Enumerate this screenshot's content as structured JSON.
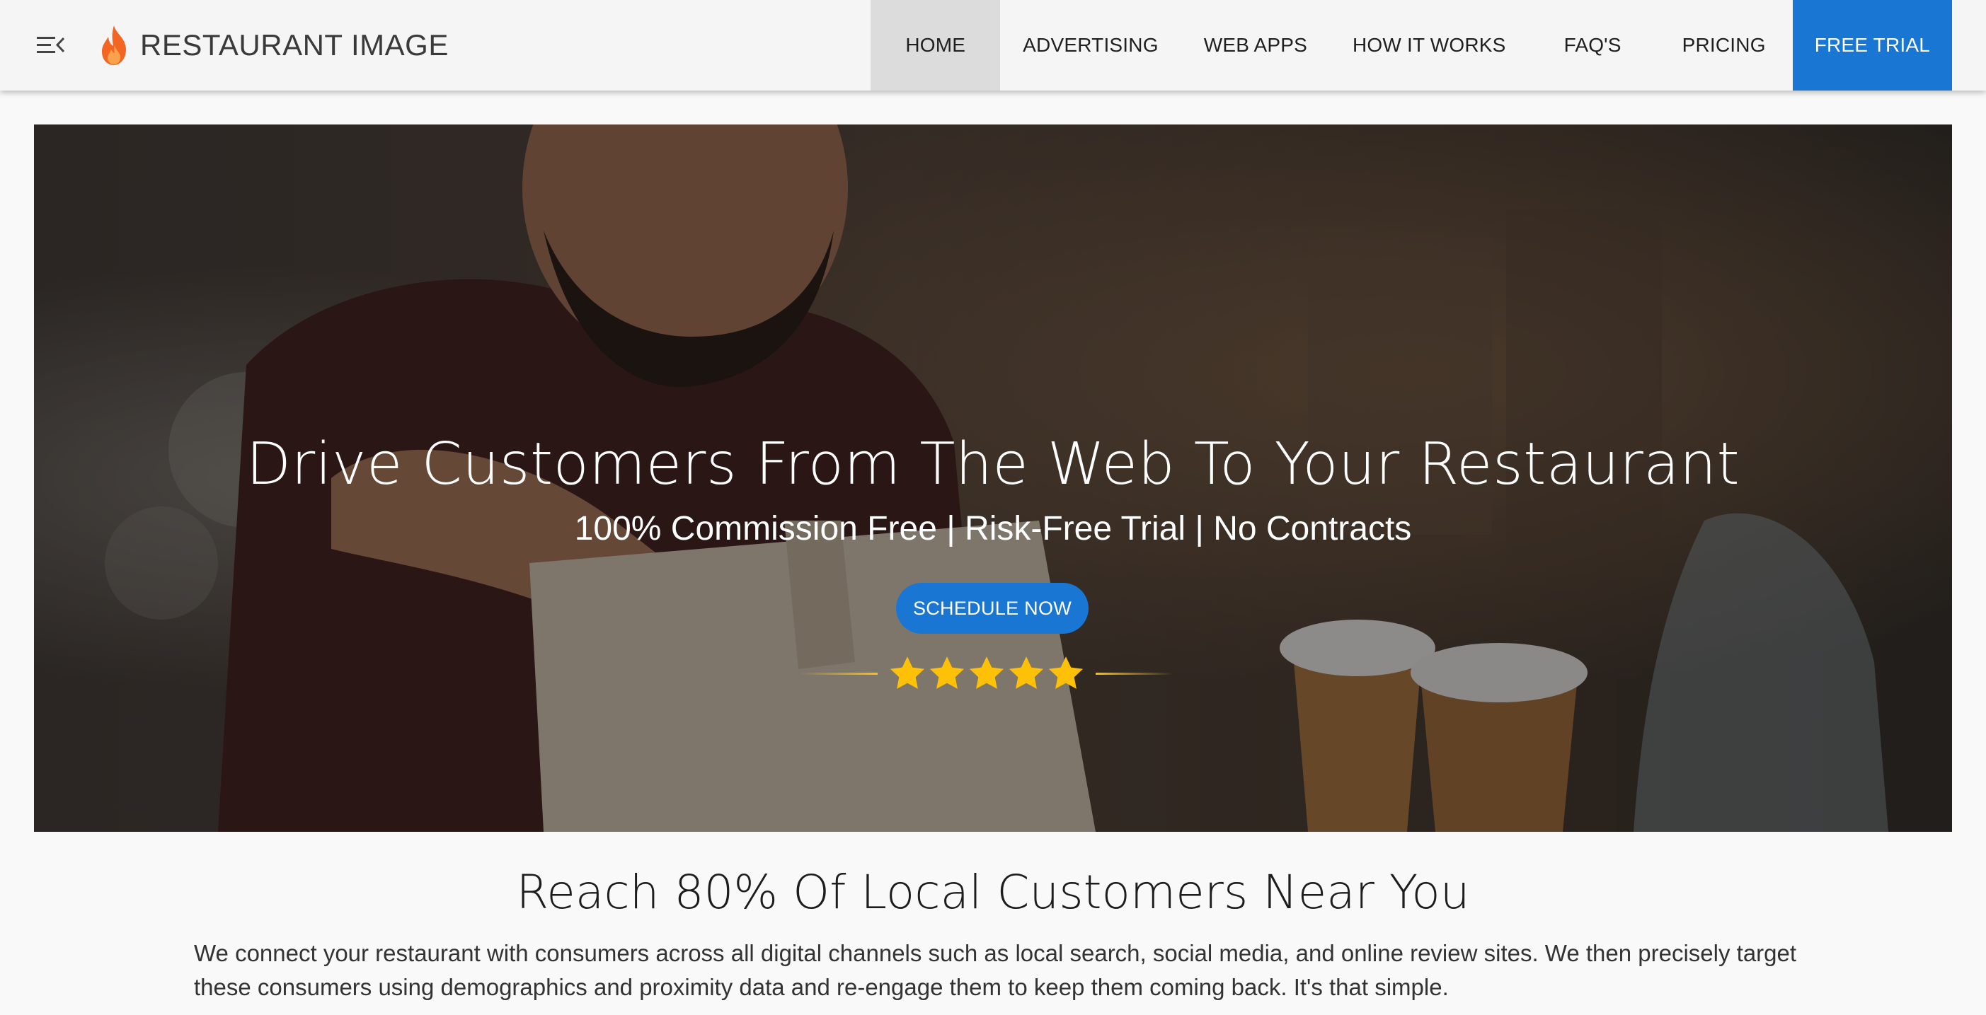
{
  "header": {
    "brand_name": "RESTAURANT IMAGE",
    "menu_icon": "menu-collapse-icon",
    "logo_icon": "flame-icon",
    "nav": {
      "home": "HOME",
      "advertising": "ADVERTISING",
      "web_apps": "WEB APPS",
      "how_it_works": "HOW IT WORKS",
      "faqs": "FAQ'S",
      "pricing": "PRICING",
      "free_trial": "FREE TRIAL"
    },
    "active_item": "HOME"
  },
  "hero": {
    "title": "Drive Customers From The Web To Your Restaurant",
    "subtitle": "100% Commission Free | Risk-Free Trial | No Contracts",
    "cta_label": "SCHEDULE NOW",
    "rating_stars": 5,
    "rating_icon": "star-icon"
  },
  "intro": {
    "heading": "Reach 80% Of Local Customers Near You",
    "body": "We connect your restaurant with consumers across all digital channels such as local search, social media, and online review sites. We then precisely target these consumers using demographics and proximity data and re-engage them to keep them coming back. It's that simple."
  },
  "colors": {
    "accent": "#1976d2",
    "star": "#ffc107",
    "flame": "#f26522",
    "header_bg": "#f5f5f5",
    "active_nav_bg": "#dcdcdc"
  }
}
